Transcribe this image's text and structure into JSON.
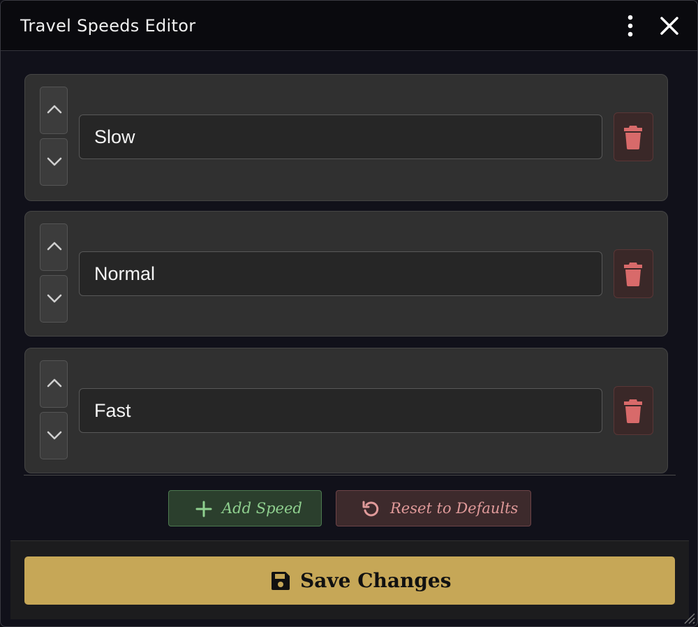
{
  "window": {
    "title": "Travel Speeds Editor"
  },
  "speeds": [
    {
      "name": "Slow"
    },
    {
      "name": "Normal"
    },
    {
      "name": "Fast"
    }
  ],
  "actions": {
    "add_label": "Add Speed",
    "reset_label": "Reset to Defaults",
    "save_label": "Save Changes"
  },
  "icons": {
    "menu": "kebab-menu-icon",
    "close": "close-icon",
    "move_up": "chevron-up-icon",
    "move_down": "chevron-down-icon",
    "delete": "trash-icon",
    "add": "plus-icon",
    "reset": "undo-icon",
    "save": "floppy-disk-icon"
  },
  "colors": {
    "accent_save": "#c6a757",
    "add_text": "#8fd08f",
    "reset_text": "#e09a9a",
    "delete_icon": "#d86a6a"
  }
}
